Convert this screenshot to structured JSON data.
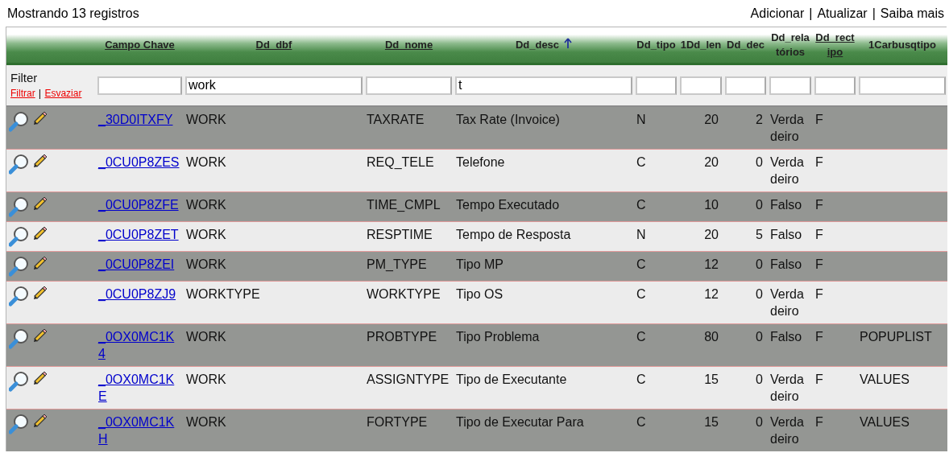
{
  "status": "Mostrando 13 registros",
  "actions": [
    "Adicionar",
    "Atualizar",
    "Saiba mais"
  ],
  "separator": "|",
  "table": {
    "columns": [
      {
        "label": "Campo Chave",
        "link": true,
        "sorted": false
      },
      {
        "label": "Dd_dbf",
        "link": true,
        "sorted": false,
        "filter": "work"
      },
      {
        "label": "Dd_nome",
        "link": true,
        "sorted": false
      },
      {
        "label": "Dd_desc",
        "link": false,
        "sorted": true,
        "filter": "t"
      },
      {
        "label": "Dd_tipo",
        "link": false,
        "sorted": false
      },
      {
        "label": "1Dd_len",
        "link": false,
        "sorted": false
      },
      {
        "label": "Dd_dec",
        "link": false,
        "sorted": false
      },
      {
        "label": "Dd_relatórios",
        "link": false,
        "sorted": false
      },
      {
        "label": "Dd_rectipo",
        "link": true,
        "sorted": false
      },
      {
        "label": "1Carbusqtipo",
        "link": false,
        "sorted": false
      }
    ],
    "filter": {
      "label": "Filter",
      "apply": "Filtrar",
      "clear": "Esvaziar"
    },
    "rows": [
      [
        "_30D0ITXFY",
        "WORK",
        "TAXRATE",
        "Tax Rate (Invoice)",
        "N",
        "20",
        "2",
        "Verdadeiro",
        "F",
        ""
      ],
      [
        "_0CU0P8ZES",
        "WORK",
        "REQ_TELE",
        "Telefone",
        "C",
        "20",
        "0",
        "Verdadeiro",
        "F",
        ""
      ],
      [
        "_0CU0P8ZFE",
        "WORK",
        "TIME_CMPL",
        "Tempo Executado",
        "C",
        "10",
        "0",
        "Falso",
        "F",
        ""
      ],
      [
        "_0CU0P8ZET",
        "WORK",
        "RESPTIME",
        "Tempo de Resposta",
        "N",
        "20",
        "5",
        "Falso",
        "F",
        ""
      ],
      [
        "_0CU0P8ZEI",
        "WORK",
        "PM_TYPE",
        "Tipo MP",
        "C",
        "12",
        "0",
        "Falso",
        "F",
        ""
      ],
      [
        "_0CU0P8ZJ9",
        "WORKTYPE",
        "WORKTYPE",
        "Tipo OS",
        "C",
        "12",
        "0",
        "Verdadeiro",
        "F",
        ""
      ],
      [
        "_0OX0MC1K4",
        "WORK",
        "PROBTYPE",
        "Tipo Problema",
        "C",
        "80",
        "0",
        "Falso",
        "F",
        "POPUPLIST"
      ],
      [
        "_0OX0MC1KE",
        "WORK",
        "ASSIGNTYPE",
        "Tipo de Executante",
        "C",
        "15",
        "0",
        "Verdadeiro",
        "F",
        "VALUES"
      ],
      [
        "_0OX0MC1KH",
        "WORK",
        "FORTYPE",
        "Tipo de Executar Para",
        "C",
        "15",
        "0",
        "Verdadeiro",
        "F",
        "VALUES"
      ]
    ]
  }
}
